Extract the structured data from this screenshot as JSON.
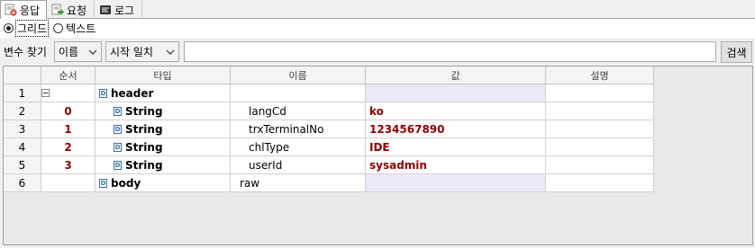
{
  "tabs": [
    {
      "label": "응답",
      "icon": "response-icon"
    },
    {
      "label": "요청",
      "icon": "request-icon"
    },
    {
      "label": "로그",
      "icon": "log-icon"
    }
  ],
  "view_mode": {
    "options": [
      {
        "label": "그리드",
        "selected": true
      },
      {
        "label": "텍스트",
        "selected": false
      }
    ]
  },
  "search": {
    "label": "변수 찾기",
    "field_select": "이름",
    "match_select": "시작 일치",
    "query": "",
    "button": "검색"
  },
  "grid": {
    "columns": [
      "순서",
      "타입",
      "이름",
      "값",
      "설명"
    ],
    "rows": [
      {
        "num": "1",
        "order": "",
        "type": "header",
        "name": "",
        "value": "",
        "desc": "",
        "level": 0,
        "expander": true
      },
      {
        "num": "2",
        "order": "0",
        "type": "String",
        "name": "langCd",
        "value": "ko",
        "desc": "",
        "level": 1
      },
      {
        "num": "3",
        "order": "1",
        "type": "String",
        "name": "trxTerminalNo",
        "value": "1234567890",
        "desc": "",
        "level": 1
      },
      {
        "num": "4",
        "order": "2",
        "type": "String",
        "name": "chlType",
        "value": "IDE",
        "desc": "",
        "level": 1
      },
      {
        "num": "5",
        "order": "3",
        "type": "String",
        "name": "userId",
        "value": "sysadmin",
        "desc": "",
        "level": 1
      },
      {
        "num": "6",
        "order": "",
        "type": "body",
        "name": "raw",
        "value": "",
        "desc": "",
        "level": 0
      }
    ]
  },
  "colors": {
    "value_text": "#8b0000",
    "empty_value_bg": "#ebe8f7",
    "type_icon": "#3a6ea5"
  }
}
